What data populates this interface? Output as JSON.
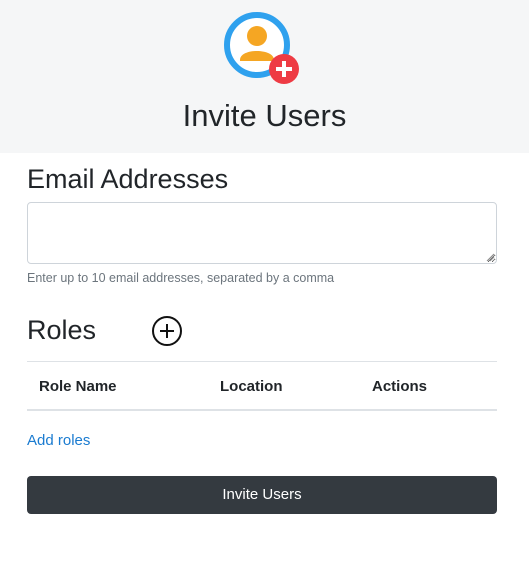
{
  "header": {
    "icon": "user-add-icon",
    "title": "Invite Users"
  },
  "email_section": {
    "heading": "Email Addresses",
    "input_value": "",
    "help_text": "Enter up to 10 email addresses, separated by a comma"
  },
  "roles_section": {
    "heading": "Roles",
    "add_icon": "plus-circle-icon",
    "table": {
      "columns": [
        "Role Name",
        "Location",
        "Actions"
      ],
      "rows": []
    },
    "add_link": "Add roles"
  },
  "submit": {
    "label": "Invite Users"
  },
  "colors": {
    "header_bg": "#f5f6f7",
    "avatar_ring": "#2fa1ee",
    "avatar_person": "#f5a623",
    "badge_red": "#ee3b44",
    "link": "#1a7bd0",
    "button_bg": "#343a40"
  }
}
